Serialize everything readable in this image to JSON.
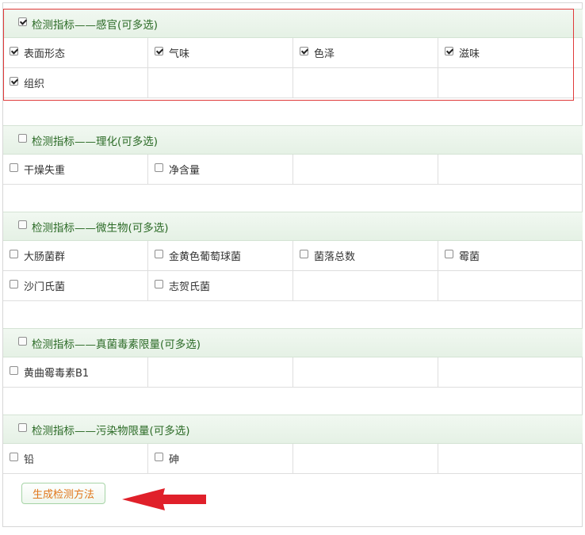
{
  "sections": [
    {
      "title": "检测指标——感官(可多选)",
      "checked": true,
      "rows": [
        [
          {
            "label": "表面形态",
            "checked": true
          },
          {
            "label": "气味",
            "checked": true
          },
          {
            "label": "色泽",
            "checked": true
          },
          {
            "label": "滋味",
            "checked": true
          }
        ],
        [
          {
            "label": "组织",
            "checked": true
          },
          null,
          null,
          null
        ]
      ]
    },
    {
      "title": "检测指标——理化(可多选)",
      "checked": false,
      "rows": [
        [
          {
            "label": "干燥失重",
            "checked": false
          },
          {
            "label": "净含量",
            "checked": false
          },
          null,
          null
        ]
      ]
    },
    {
      "title": "检测指标——微生物(可多选)",
      "checked": false,
      "rows": [
        [
          {
            "label": "大肠菌群",
            "checked": false
          },
          {
            "label": "金黄色葡萄球菌",
            "checked": false
          },
          {
            "label": "菌落总数",
            "checked": false
          },
          {
            "label": "霉菌",
            "checked": false
          }
        ],
        [
          {
            "label": "沙门氏菌",
            "checked": false
          },
          {
            "label": "志贺氏菌",
            "checked": false
          },
          null,
          null
        ]
      ]
    },
    {
      "title": "检测指标——真菌毒素限量(可多选)",
      "checked": false,
      "rows": [
        [
          {
            "label": "黄曲霉毒素B1",
            "checked": false
          },
          null,
          null,
          null
        ]
      ]
    },
    {
      "title": "检测指标——污染物限量(可多选)",
      "checked": false,
      "rows": [
        [
          {
            "label": "铅",
            "checked": false
          },
          {
            "label": "砷",
            "checked": false
          },
          null,
          null
        ]
      ]
    }
  ],
  "generate_button": {
    "label": "生成检测方法"
  },
  "colors": {
    "section_title": "#2c6b27",
    "highlight": "#e03a3a",
    "button_text": "#e0761a",
    "arrow": "#e0202a"
  }
}
